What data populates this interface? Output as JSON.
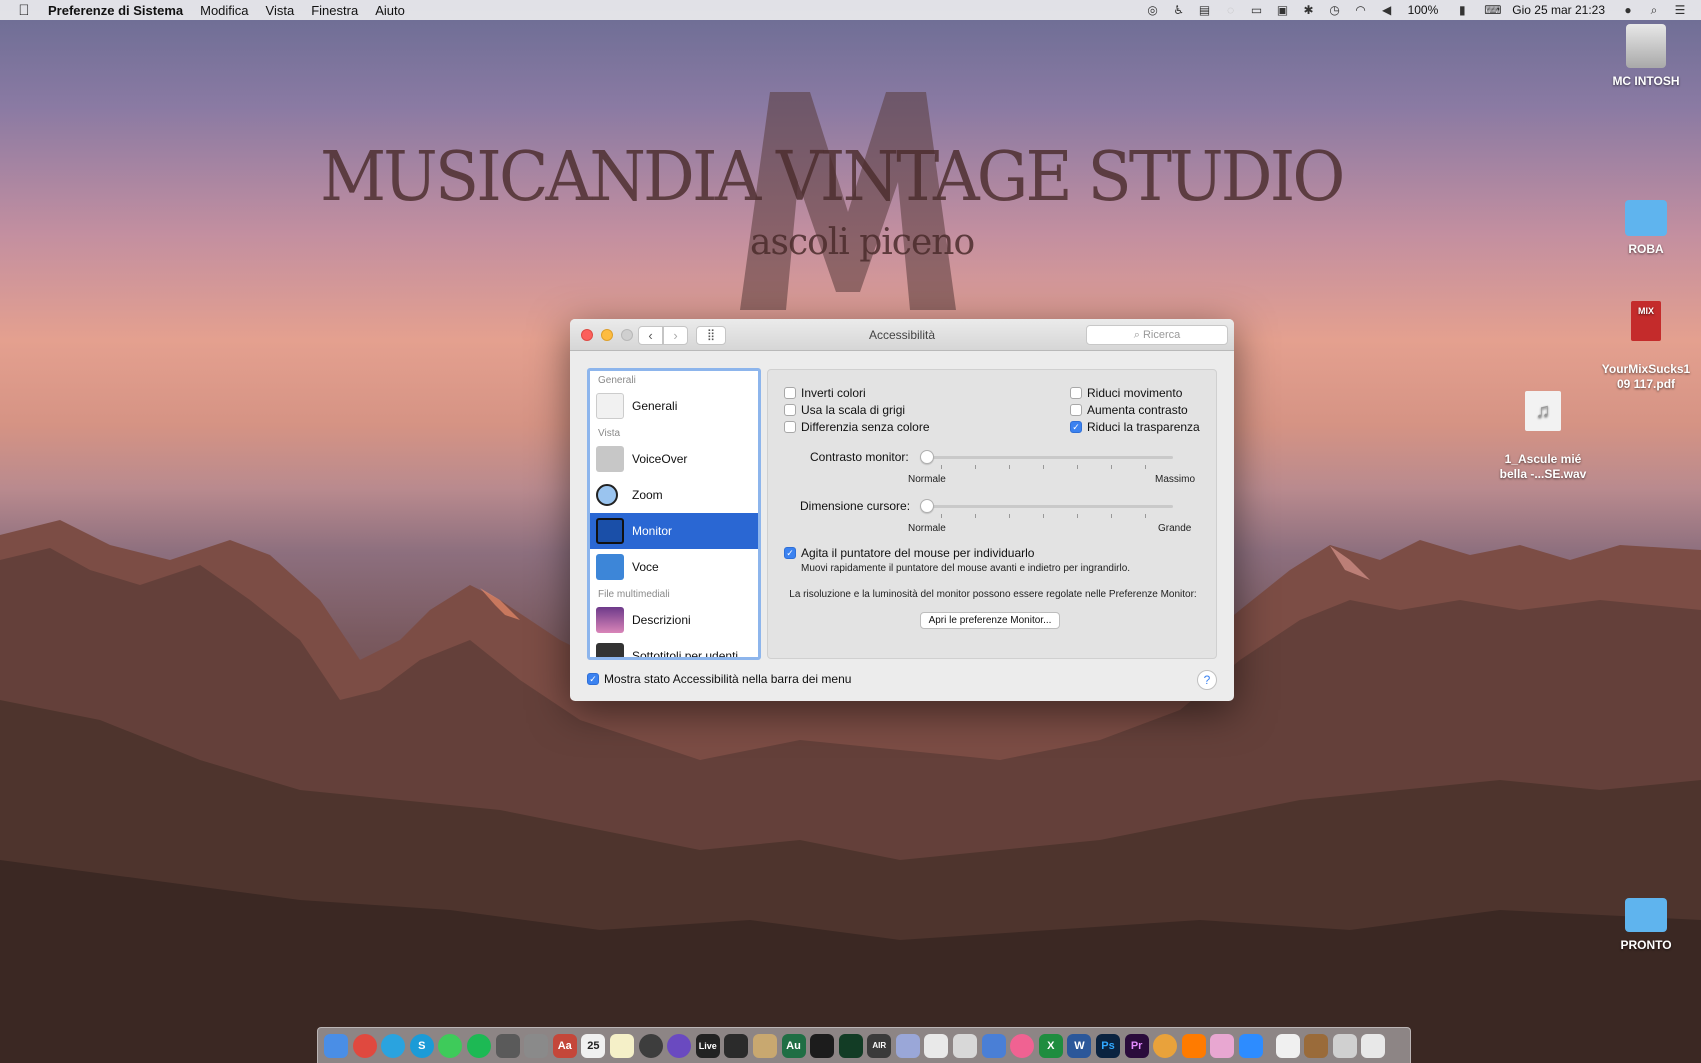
{
  "menubar": {
    "app": "Preferenze di Sistema",
    "items": [
      "Modifica",
      "Vista",
      "Finestra",
      "Aiuto"
    ],
    "battery": "100%",
    "datetime": "Gio 25 mar  21:23"
  },
  "wallpaper": {
    "title": "MUSICANDIA VINTAGE STUDIO",
    "subtitle": "ascoli piceno",
    "logo_letter": "M"
  },
  "desktop": {
    "icons": [
      {
        "label": "MC INTOSH"
      },
      {
        "label": "ROBA"
      },
      {
        "label": "YourMixSucks1\n09 117.pdf"
      },
      {
        "label": "1_Ascule mié\nbella -...SE.wav"
      },
      {
        "label": "PRONTO"
      }
    ],
    "pdf_badge": "MIX"
  },
  "window": {
    "title": "Accessibilità",
    "search_placeholder": "Ricerca",
    "sidebar": {
      "sections": [
        "Generali",
        "Vista",
        "File multimediali"
      ],
      "items": [
        "Generali",
        "VoiceOver",
        "Zoom",
        "Monitor",
        "Voce",
        "Descrizioni",
        "Sottotitoli per udenti"
      ]
    },
    "options": {
      "invert": "Inverti colori",
      "grayscale": "Usa la scala di grigi",
      "differentiate": "Differenzia senza colore",
      "reduce_motion": "Riduci movimento",
      "increase_contrast": "Aumenta contrasto",
      "reduce_transparency": "Riduci la trasparenza",
      "reduce_transparency_checked": true
    },
    "contrast": {
      "label": "Contrasto monitor:",
      "min": "Normale",
      "max": "Massimo",
      "value": 0
    },
    "cursor": {
      "label": "Dimensione cursore:",
      "min": "Normale",
      "max": "Grande",
      "value": 0
    },
    "shake": {
      "label": "Agita il puntatore del mouse per individuarlo",
      "desc": "Muovi rapidamente il puntatore del mouse avanti e indietro per ingrandirlo.",
      "checked": true
    },
    "note": "La risoluzione e la luminosità del monitor possono essere regolate nelle Preferenze Monitor:",
    "open_button": "Apri le preferenze Monitor...",
    "footer_checkbox": "Mostra stato Accessibilità nella barra dei menu",
    "help": "?"
  },
  "dock": {
    "colors": [
      "#4a8ee6",
      "#e0493f",
      "#2aa3df",
      "#1b9bd7",
      "#3ecb5a",
      "#1db954",
      "#5a5a5a",
      "#8a8a8a",
      "#c4473a",
      "#f0f0f0",
      "#f5f0c8",
      "#3d3d3d",
      "#6a4ac0",
      "#222",
      "#2b2b2b",
      "#c8a870",
      "#1f6e44",
      "#1c1c1c",
      "#123c25",
      "#3a3a3a",
      "#9aa7d8",
      "#e9e9e9",
      "#d8d8d8",
      "#4a7fd6",
      "#f06292",
      "#1f8d3f",
      "#2b579a",
      "#0b2340",
      "#2a0b3b",
      "#e9a23b",
      "#ff7b00",
      "#e8a7d1",
      "#2d8cff",
      "#f0f0f0",
      "#9a6b3a",
      "#d0d0d0",
      "#e8e8e8"
    ],
    "labels": {
      "live": "Live",
      "au": "Au",
      "air": "AIR",
      "ps": "Ps",
      "pr": "Pr",
      "w": "W",
      "x": "X",
      "cal": "25"
    }
  }
}
